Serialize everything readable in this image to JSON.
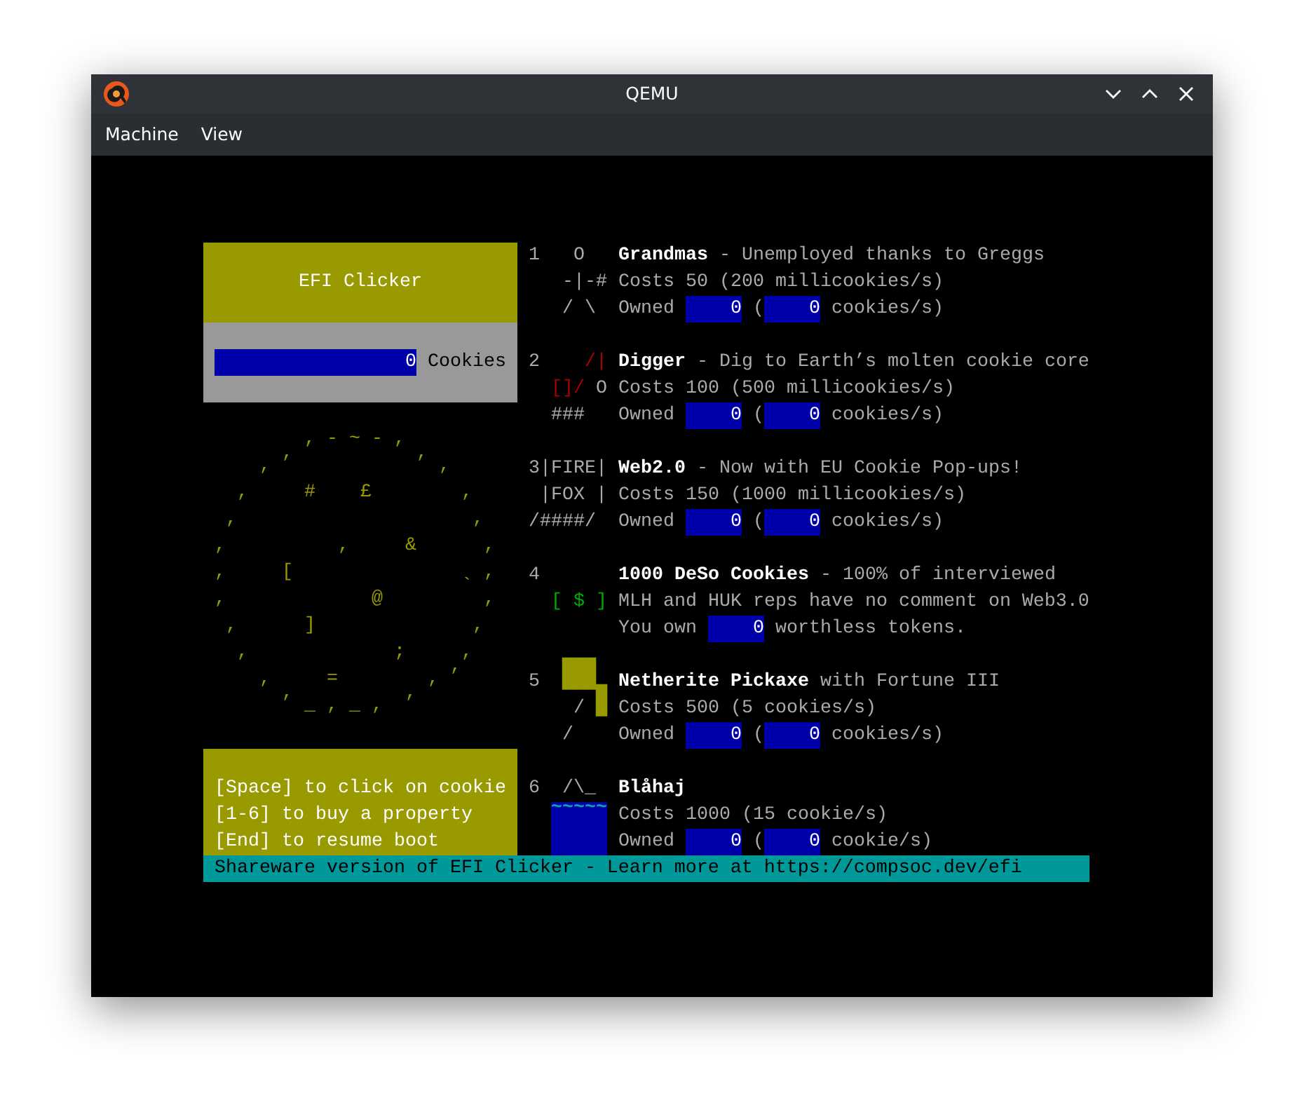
{
  "window": {
    "title": "QEMU"
  },
  "menu": [
    {
      "label": "Machine"
    },
    {
      "label": "View"
    }
  ],
  "game": {
    "title": "EFI Clicker",
    "cookies": {
      "value": "0",
      "label": "Cookies"
    },
    "cookie_art": "         , - ~ - ,\n       ,           ,\n     ,               ,\n\n   ,     #    £        ,\n\n  ,                     ,\n\n ,          ,     &      ,\n\n ,     [                 ,\n                       `\n ,             @         ,\n\n  ,      ]              ,\n\n   ,             ;     ,\n                      ,\n     ,     =        ,\n       ,          ,\n         _ , _ ,",
    "help_lines": [
      "[Space] to click on cookie",
      "[1-6] to buy a property",
      "[End] to resume boot"
    ],
    "properties": [
      {
        "number": "1",
        "rows": [
          {
            "art": [
              {
                "kind": "glyph",
                "text": "   O",
                "color": "#aaaaaa"
              }
            ],
            "parts": [
              {
                "kind": "name",
                "text": "Grandmas"
              },
              {
                "kind": "text",
                "text": " - Unemployed thanks to Greggs"
              }
            ]
          },
          {
            "art": [
              {
                "kind": "glyph",
                "text": "   -|-#",
                "color": "#aaaaaa"
              }
            ],
            "parts": [
              {
                "kind": "text",
                "text": "Costs 50 (200 millicookies/s)"
              }
            ]
          },
          {
            "art": [
              {
                "kind": "glyph",
                "text": "   / \\",
                "color": "#aaaaaa"
              }
            ],
            "parts": [
              {
                "kind": "text",
                "text": "Owned "
              },
              {
                "kind": "counter",
                "text": "0"
              },
              {
                "kind": "text",
                "text": " ("
              },
              {
                "kind": "counter",
                "text": "0"
              },
              {
                "kind": "text",
                "text": " cookies/s)"
              }
            ]
          }
        ]
      },
      {
        "number": "2",
        "rows": [
          {
            "art": [
              {
                "kind": "glyph",
                "text": "    /|",
                "color": "#aa0000"
              }
            ],
            "parts": [
              {
                "kind": "name",
                "text": "Digger"
              },
              {
                "kind": "text",
                "text": " - Dig to Earth’s molten cookie core"
              }
            ]
          },
          {
            "art": [
              {
                "kind": "glyph",
                "text": "  []/",
                "color": "#aa0000"
              },
              {
                "kind": "glyph",
                "text": " O",
                "color": "#aaaaaa"
              }
            ],
            "parts": [
              {
                "kind": "text",
                "text": "Costs 100 (500 millicookies/s)"
              }
            ]
          },
          {
            "art": [
              {
                "kind": "glyph",
                "text": "  ###",
                "color": "#aaaaaa"
              }
            ],
            "parts": [
              {
                "kind": "text",
                "text": "Owned "
              },
              {
                "kind": "counter",
                "text": "0"
              },
              {
                "kind": "text",
                "text": " ("
              },
              {
                "kind": "counter",
                "text": "0"
              },
              {
                "kind": "text",
                "text": " cookies/s)"
              }
            ]
          }
        ]
      },
      {
        "number": "3",
        "rows": [
          {
            "art": [
              {
                "kind": "glyph",
                "text": "|FIRE|",
                "color": "#aaaaaa"
              }
            ],
            "parts": [
              {
                "kind": "name",
                "text": "Web2.0"
              },
              {
                "kind": "text",
                "text": " - Now with EU Cookie Pop-ups!"
              }
            ]
          },
          {
            "art": [
              {
                "kind": "glyph",
                "text": " |FOX |",
                "color": "#aaaaaa"
              }
            ],
            "parts": [
              {
                "kind": "text",
                "text": "Costs 150 (1000 millicookies/s)"
              }
            ]
          },
          {
            "art": [
              {
                "kind": "glyph",
                "text": "/####/",
                "color": "#aaaaaa"
              }
            ],
            "parts": [
              {
                "kind": "text",
                "text": "Owned "
              },
              {
                "kind": "counter",
                "text": "0"
              },
              {
                "kind": "text",
                "text": " ("
              },
              {
                "kind": "counter",
                "text": "0"
              },
              {
                "kind": "text",
                "text": " cookies/s)"
              }
            ]
          }
        ]
      },
      {
        "number": "4",
        "rows": [
          {
            "parts": [
              {
                "kind": "name",
                "text": "1000 DeSo Cookies"
              },
              {
                "kind": "text",
                "text": " - 100% of interviewed"
              }
            ]
          },
          {
            "art": [
              {
                "kind": "glyph",
                "text": "  [ $ ]",
                "color": "#00aa00"
              }
            ],
            "parts": [
              {
                "kind": "text",
                "text": "MLH and HUK reps have no comment on Web3.0"
              }
            ]
          },
          {
            "parts": [
              {
                "kind": "text",
                "text": "You own "
              },
              {
                "kind": "counter",
                "text": "0"
              },
              {
                "kind": "text",
                "text": " worthless tokens."
              }
            ]
          }
        ]
      },
      {
        "number": "5",
        "rows": [
          {
            "art": [
              {
                "kind": "block",
                "text": "  ███",
                "color": "#999900"
              }
            ],
            "parts": [
              {
                "kind": "name",
                "text": "Netherite Pickaxe"
              },
              {
                "kind": "text",
                "text": " with Fortune III"
              }
            ]
          },
          {
            "art": [
              {
                "kind": "glyph",
                "text": "    /",
                "color": "#aaaaaa"
              },
              {
                "kind": "block",
                "text": " █",
                "color": "#999900"
              }
            ],
            "parts": [
              {
                "kind": "text",
                "text": "Costs 500 (5 cookies/s)"
              }
            ]
          },
          {
            "art": [
              {
                "kind": "glyph",
                "text": "   /",
                "color": "#aaaaaa"
              }
            ],
            "parts": [
              {
                "kind": "text",
                "text": "Owned "
              },
              {
                "kind": "counter",
                "text": "0"
              },
              {
                "kind": "text",
                "text": " ("
              },
              {
                "kind": "counter",
                "text": "0"
              },
              {
                "kind": "text",
                "text": " cookies/s)"
              }
            ]
          }
        ]
      },
      {
        "number": "6",
        "rows": [
          {
            "art": [
              {
                "kind": "glyph",
                "text": "  /\\_",
                "color": "#aaaaaa"
              }
            ],
            "parts": [
              {
                "kind": "name",
                "text": "Blåhaj"
              }
            ]
          },
          {
            "art": [
              {
                "kind": "water",
                "text": "  ~~~~~"
              }
            ],
            "parts": [
              {
                "kind": "text",
                "text": "Costs 1000 (15 cookie/s)"
              }
            ]
          },
          {
            "parts": [
              {
                "kind": "text",
                "text": "Owned "
              },
              {
                "kind": "counter",
                "text": "0"
              },
              {
                "kind": "text",
                "text": " ("
              },
              {
                "kind": "counter",
                "text": "0"
              },
              {
                "kind": "text",
                "text": " cookie/s)"
              }
            ]
          }
        ]
      }
    ],
    "status_bar": "Shareware version of EFI Clicker - Learn more at https://compsoc.dev/efi"
  }
}
